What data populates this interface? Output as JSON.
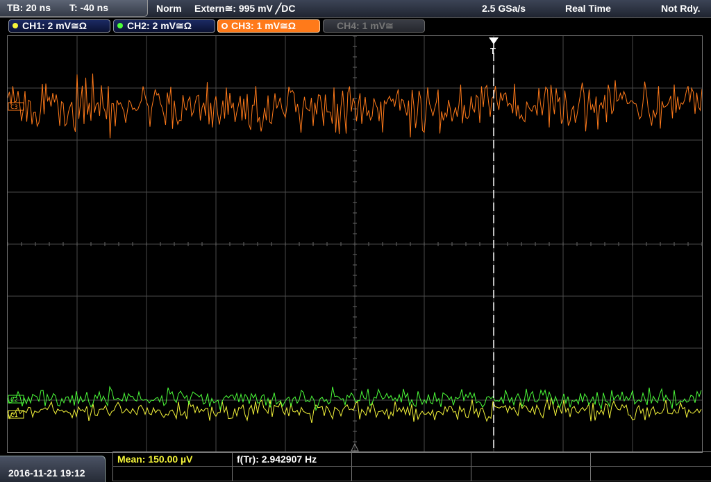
{
  "topbar": {
    "timebase": "TB: 20 ns",
    "trigger_time": "T: -40 ns",
    "trigger_mode": "Norm",
    "trigger_source": "Extern≅: 995 mV ╱DC",
    "sample_rate": "2.5 GSa/s",
    "acq_mode": "Real Time",
    "status": "Not Rdy."
  },
  "channels": [
    {
      "label": "CH1: 2 mV≅Ω",
      "color": "#f5f53a"
    },
    {
      "label": "CH2: 2 mV≅Ω",
      "color": "#4cff3a"
    },
    {
      "label": "CH3: 1 mV≅Ω",
      "color": "#ff7a1a"
    },
    {
      "label": "CH4: 1 mV≅",
      "color": "#888888"
    }
  ],
  "screen": {
    "trigger_marker": "T",
    "ch3_marker": "C3",
    "ch2_marker": "C2",
    "ch1_marker": "C1"
  },
  "footer": {
    "datetime": "2016-11-21 19:12",
    "mean_label": "Mean: 150.00 µV",
    "freq_label": "f(Tr): 2.942907 Hz"
  },
  "colors": {
    "ch1": "#f5f53a",
    "ch2": "#4cff3a",
    "ch3": "#ff7a1a",
    "grid": "#4a4a4a"
  }
}
